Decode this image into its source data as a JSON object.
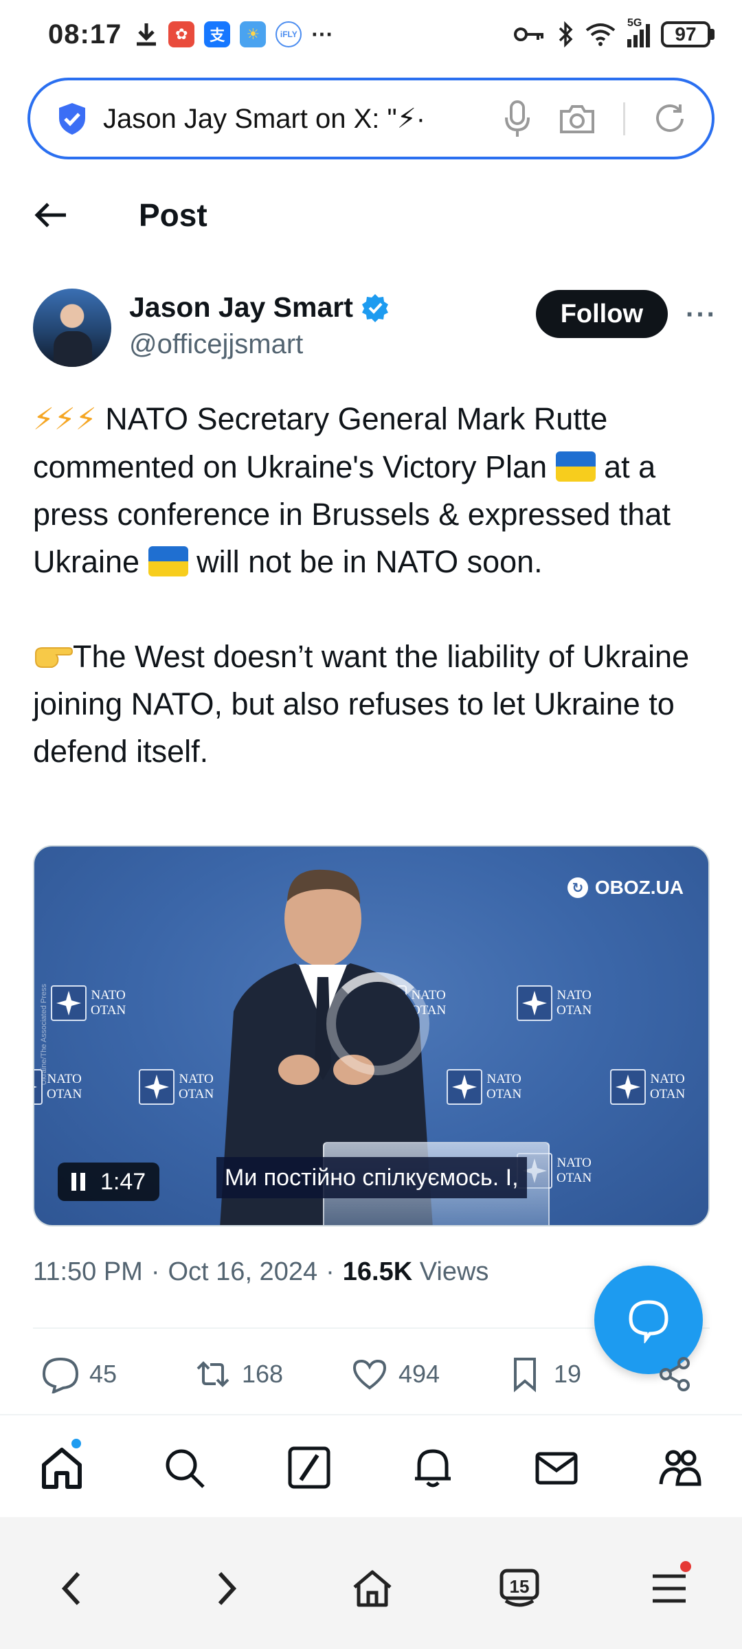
{
  "status_bar": {
    "time": "08:17",
    "more": "···",
    "network": "5G",
    "battery": "97"
  },
  "browser": {
    "url_text": "Jason Jay Smart on X: \"⚡·"
  },
  "header": {
    "title": "Post"
  },
  "author": {
    "name": "Jason Jay Smart",
    "handle": "@officejjsmart",
    "follow_label": "Follow",
    "more_label": "···"
  },
  "post": {
    "line1_prefix": "⚡⚡⚡",
    "paragraph1_a": "NATO Secretary General Mark Rutte commented on Ukraine's Victory Plan",
    "paragraph1_b": "at a press conference in Brussels & expressed that Ukraine",
    "paragraph1_c": "will not be in NATO soon.",
    "paragraph2": "The West doesn’t want the liability of Ukraine joining NATO, but also refuses to let Ukraine to defend itself."
  },
  "video": {
    "watermark": "OBOZ.UA",
    "duration": "1:47",
    "subtitle": "Ми постійно спілкуємось. І,",
    "credit": "Ukraine/The Associated Press",
    "nato_en": "NATO",
    "nato_fr": "OTAN"
  },
  "meta": {
    "time": "11:50 PM",
    "date": "Oct 16, 2024",
    "views_count": "16.5K",
    "views_label": "Views",
    "sep": "·"
  },
  "actions": {
    "replies": "45",
    "reposts": "168",
    "likes": "494",
    "bookmarks": "19"
  },
  "system_nav": {
    "tabs_count": "15"
  },
  "colors": {
    "accent": "#1d9bf0",
    "url_border": "#2a6ff0",
    "text": "#0f1419",
    "muted": "#536471"
  }
}
